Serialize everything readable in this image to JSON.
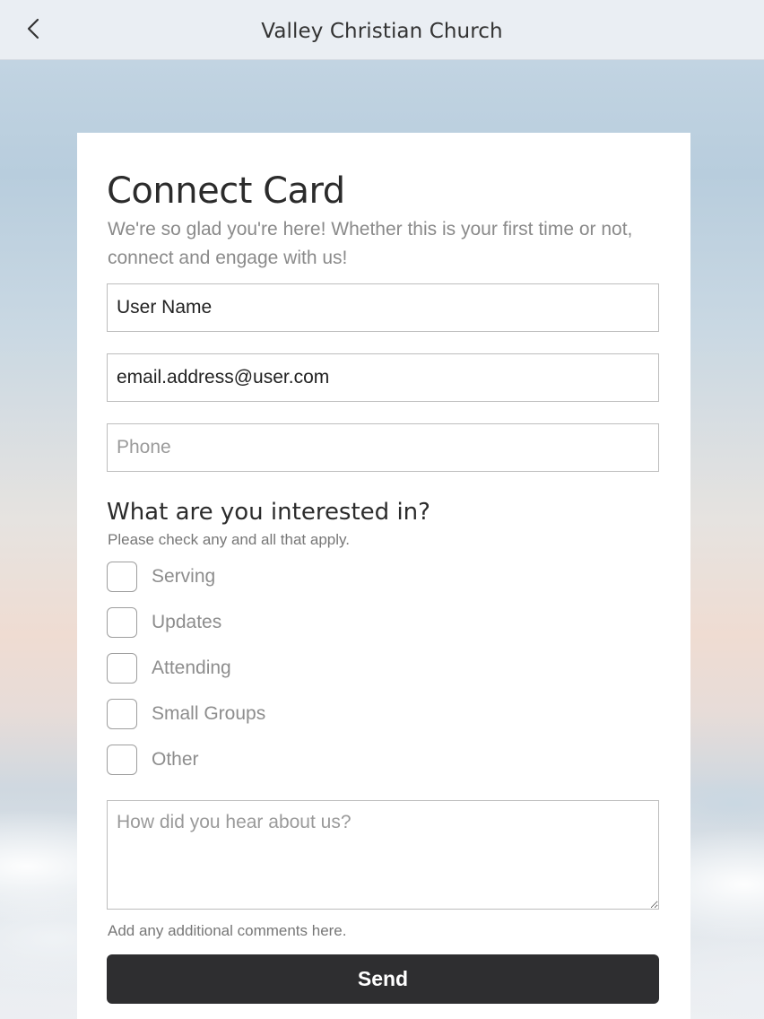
{
  "header": {
    "title": "Valley Christian Church",
    "back_icon": "chevron-left-icon"
  },
  "card": {
    "title": "Connect Card",
    "subtitle": "We're so glad you're here! Whether this is your first time or not, connect and engage with us!",
    "fields": {
      "name_value": "User Name",
      "email_value": "email.address@user.com",
      "phone_placeholder": "Phone"
    },
    "interests": {
      "title": "What are you interested in?",
      "hint": "Please check any and all that apply.",
      "options": [
        "Serving",
        "Updates",
        "Attending",
        "Small Groups",
        "Other"
      ]
    },
    "comments": {
      "placeholder": "How did you hear about us?",
      "hint": "Add any additional comments here."
    },
    "send_label": "Send"
  },
  "colors": {
    "button_bg": "#2e2e30",
    "header_bg": "#eaeef3"
  }
}
